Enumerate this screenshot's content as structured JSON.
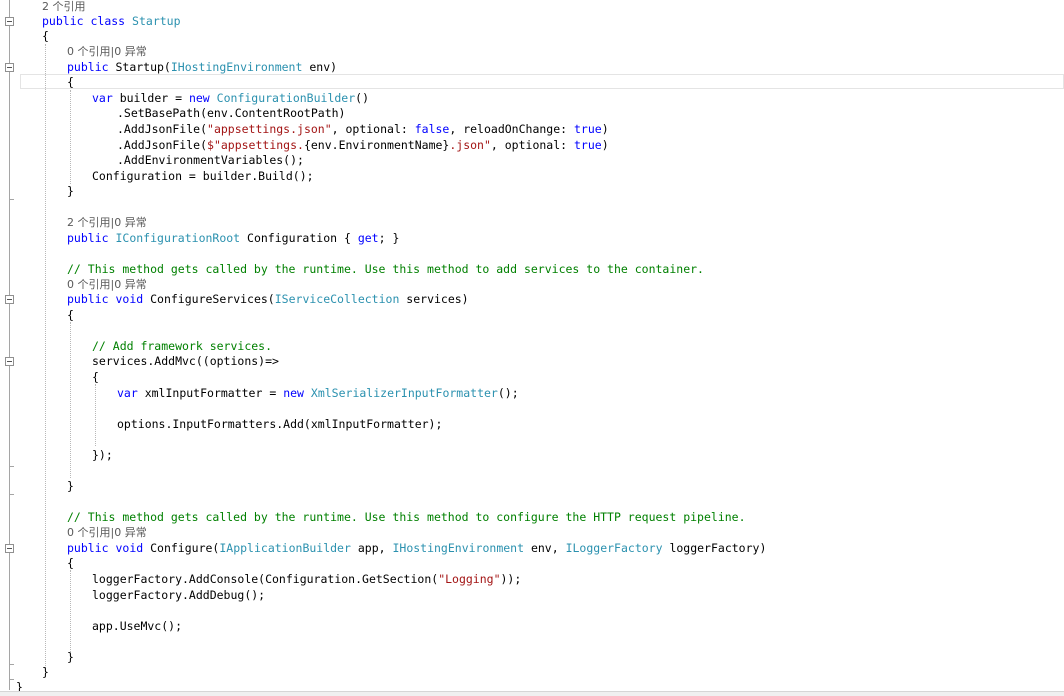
{
  "editor": {
    "language": "C#",
    "current_line_index": 5,
    "colors": {
      "keyword": "#0000ff",
      "type": "#2b91af",
      "string": "#a31515",
      "comment": "#008000",
      "codelens": "#5a5a5a",
      "text": "#000000"
    },
    "lines": [
      [
        {
          "t": "2 个引用",
          "c": "lens"
        }
      ],
      [
        {
          "t": "public",
          "c": "kw"
        },
        {
          "t": " "
        },
        {
          "t": "class",
          "c": "kw"
        },
        {
          "t": " "
        },
        {
          "t": "Startup",
          "c": "ty"
        }
      ],
      [
        {
          "t": "{"
        }
      ],
      [
        {
          "t": "0 个引用|0 异常",
          "c": "lens"
        }
      ],
      [
        {
          "t": "public",
          "c": "kw"
        },
        {
          "t": " Startup("
        },
        {
          "t": "IHostingEnvironment",
          "c": "ty"
        },
        {
          "t": " env)"
        }
      ],
      [
        {
          "t": "{"
        }
      ],
      [
        {
          "t": "var",
          "c": "kw"
        },
        {
          "t": " builder = "
        },
        {
          "t": "new",
          "c": "kw"
        },
        {
          "t": " "
        },
        {
          "t": "ConfigurationBuilder",
          "c": "ty"
        },
        {
          "t": "()"
        }
      ],
      [
        {
          "t": ".SetBasePath(env.ContentRootPath)"
        }
      ],
      [
        {
          "t": ".AddJsonFile("
        },
        {
          "t": "\"appsettings.json\"",
          "c": "str"
        },
        {
          "t": ", optional: "
        },
        {
          "t": "false",
          "c": "kw"
        },
        {
          "t": ", reloadOnChange: "
        },
        {
          "t": "true",
          "c": "kw"
        },
        {
          "t": ")"
        }
      ],
      [
        {
          "t": ".AddJsonFile("
        },
        {
          "t": "$\"appsettings.",
          "c": "str"
        },
        {
          "t": "{env.EnvironmentName}"
        },
        {
          "t": ".json\"",
          "c": "str"
        },
        {
          "t": ", optional: "
        },
        {
          "t": "true",
          "c": "kw"
        },
        {
          "t": ")"
        }
      ],
      [
        {
          "t": ".AddEnvironmentVariables();"
        }
      ],
      [
        {
          "t": "Configuration = builder.Build();"
        }
      ],
      [
        {
          "t": "}"
        }
      ],
      [
        {
          "t": ""
        }
      ],
      [
        {
          "t": "2 个引用|0 异常",
          "c": "lens"
        }
      ],
      [
        {
          "t": "public",
          "c": "kw"
        },
        {
          "t": " "
        },
        {
          "t": "IConfigurationRoot",
          "c": "ty"
        },
        {
          "t": " Configuration { "
        },
        {
          "t": "get",
          "c": "kw"
        },
        {
          "t": "; }"
        }
      ],
      [
        {
          "t": ""
        }
      ],
      [
        {
          "t": "// This method gets called by the runtime. Use this method to add services to the container.",
          "c": "cm"
        }
      ],
      [
        {
          "t": "0 个引用|0 异常",
          "c": "lens"
        }
      ],
      [
        {
          "t": "public",
          "c": "kw"
        },
        {
          "t": " "
        },
        {
          "t": "void",
          "c": "kw"
        },
        {
          "t": " ConfigureServices("
        },
        {
          "t": "IServiceCollection",
          "c": "ty"
        },
        {
          "t": " services)"
        }
      ],
      [
        {
          "t": "{"
        }
      ],
      [
        {
          "t": ""
        }
      ],
      [
        {
          "t": "// Add framework services.",
          "c": "cm"
        }
      ],
      [
        {
          "t": "services.AddMvc((options)=>"
        }
      ],
      [
        {
          "t": "{"
        }
      ],
      [
        {
          "t": "var",
          "c": "kw"
        },
        {
          "t": " xmlInputFormatter = "
        },
        {
          "t": "new",
          "c": "kw"
        },
        {
          "t": " "
        },
        {
          "t": "XmlSerializerInputFormatter",
          "c": "ty"
        },
        {
          "t": "();"
        }
      ],
      [
        {
          "t": ""
        }
      ],
      [
        {
          "t": "options.InputFormatters.Add(xmlInputFormatter);"
        }
      ],
      [
        {
          "t": ""
        }
      ],
      [
        {
          "t": "});"
        }
      ],
      [
        {
          "t": ""
        }
      ],
      [
        {
          "t": "}"
        }
      ],
      [
        {
          "t": ""
        }
      ],
      [
        {
          "t": "// This method gets called by the runtime. Use this method to configure the HTTP request pipeline.",
          "c": "cm"
        }
      ],
      [
        {
          "t": "0 个引用|0 异常",
          "c": "lens"
        }
      ],
      [
        {
          "t": "public",
          "c": "kw"
        },
        {
          "t": " "
        },
        {
          "t": "void",
          "c": "kw"
        },
        {
          "t": " Configure("
        },
        {
          "t": "IApplicationBuilder",
          "c": "ty"
        },
        {
          "t": " app, "
        },
        {
          "t": "IHostingEnvironment",
          "c": "ty"
        },
        {
          "t": " env, "
        },
        {
          "t": "ILoggerFactory",
          "c": "ty"
        },
        {
          "t": " loggerFactory)"
        }
      ],
      [
        {
          "t": "{"
        }
      ],
      [
        {
          "t": "loggerFactory.AddConsole(Configuration.GetSection("
        },
        {
          "t": "\"Logging\"",
          "c": "str"
        },
        {
          "t": "));"
        }
      ],
      [
        {
          "t": "loggerFactory.AddDebug();"
        }
      ],
      [
        {
          "t": ""
        }
      ],
      [
        {
          "t": "app.UseMvc();"
        }
      ],
      [
        {
          "t": ""
        }
      ],
      [
        {
          "t": "}"
        }
      ],
      [
        {
          "t": "}"
        }
      ],
      [
        {
          "t": "}"
        }
      ]
    ]
  }
}
